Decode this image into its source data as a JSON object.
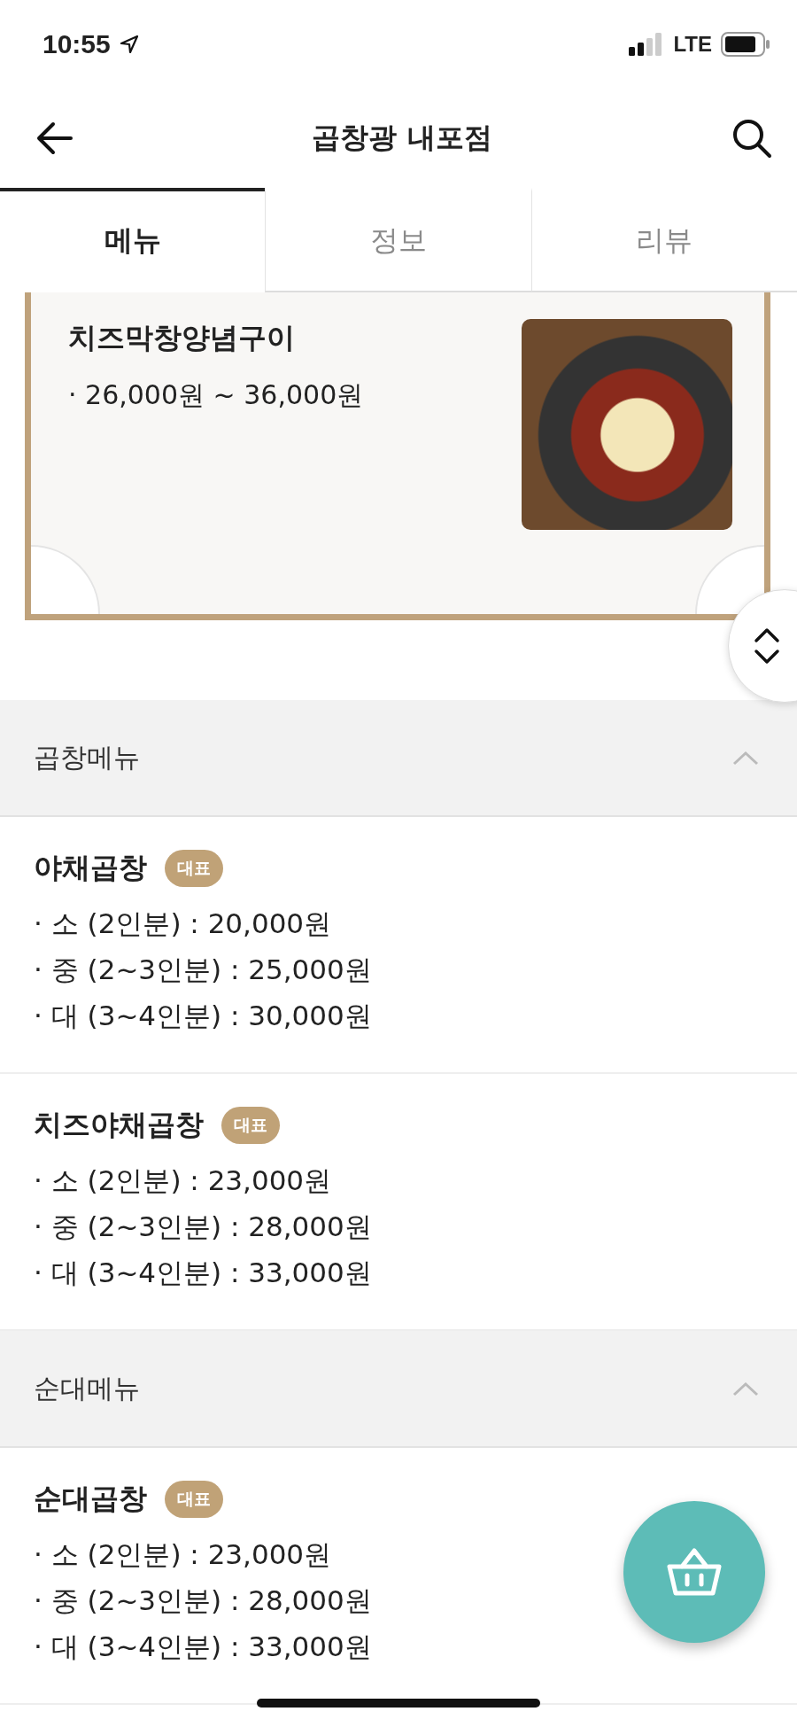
{
  "status_bar": {
    "time": "10:55",
    "network": "LTE"
  },
  "header": {
    "title": "곱창광 내포점"
  },
  "tabs": [
    {
      "label": "메뉴",
      "selected": true
    },
    {
      "label": "정보",
      "selected": false
    },
    {
      "label": "리뷰",
      "selected": false
    }
  ],
  "featured": {
    "name": "치즈막창양념구이",
    "price": "· 26,000원 ~ 36,000원"
  },
  "sections": [
    {
      "title": "곱창메뉴",
      "expanded": true,
      "items": [
        {
          "name": "야채곱창",
          "badge": "대표",
          "prices": [
            "· 소 (2인분) : 20,000원",
            "· 중 (2~3인분) : 25,000원",
            "· 대 (3~4인분) : 30,000원"
          ]
        },
        {
          "name": "치즈야채곱창",
          "badge": "대표",
          "prices": [
            "· 소 (2인분) : 23,000원",
            "· 중 (2~3인분) : 28,000원",
            "· 대 (3~4인분) : 33,000원"
          ]
        }
      ]
    },
    {
      "title": "순대메뉴",
      "expanded": true,
      "items": [
        {
          "name": "순대곱창",
          "badge": "대표",
          "prices": [
            "· 소 (2인분) : 23,000원",
            "· 중 (2~3인분) : 28,000원",
            "· 대 (3~4인분) : 33,000원"
          ]
        }
      ]
    }
  ]
}
